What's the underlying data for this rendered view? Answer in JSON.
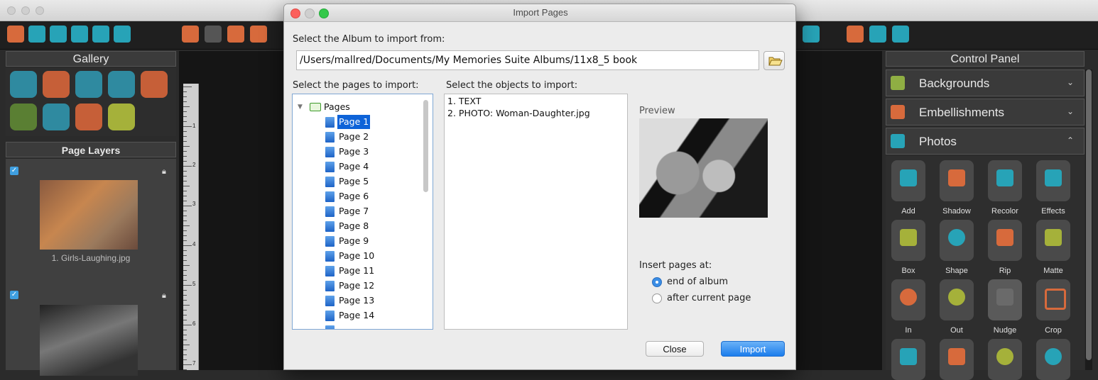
{
  "dialog": {
    "title": "Import Pages",
    "album_label": "Select the Album to import from:",
    "album_path": "/Users/mallred/Documents/My Memories Suite Albums/11x8_5 book",
    "pages_label": "Select the pages to import:",
    "objects_label": "Select the objects to import:",
    "tree_root": "Pages",
    "pages": [
      "Page 1",
      "Page 2",
      "Page 3",
      "Page 4",
      "Page 5",
      "Page 6",
      "Page 7",
      "Page 8",
      "Page 9",
      "Page 10",
      "Page 11",
      "Page 12",
      "Page 13",
      "Page 14"
    ],
    "selected_page": "Page 1",
    "objects": [
      "1. TEXT",
      "2. PHOTO: Woman-Daughter.jpg"
    ],
    "preview_label": "Preview",
    "insert_label": "Insert pages at:",
    "insert_options": [
      "end of album",
      "after current page"
    ],
    "insert_selected": "end of album",
    "close_label": "Close",
    "import_label": "Import"
  },
  "gallery": {
    "title": "Gallery"
  },
  "page_layers": {
    "title": "Page Layers",
    "items": [
      {
        "caption": "1. Girls-Laughing.jpg",
        "checked": true
      },
      {
        "caption": "",
        "checked": true
      }
    ]
  },
  "ruler": {
    "numbers": [
      "1",
      "2",
      "3",
      "4",
      "5",
      "6",
      "7"
    ]
  },
  "control_panel": {
    "title": "Control Panel",
    "sections": [
      {
        "label": "Backgrounds",
        "icon": "landscape-icon",
        "state": "collapsed"
      },
      {
        "label": "Embellishments",
        "icon": "flower-icon",
        "state": "collapsed"
      },
      {
        "label": "Photos",
        "icon": "camera-icon",
        "state": "expanded"
      }
    ],
    "tools": [
      "Add",
      "Shadow",
      "Recolor",
      "Effects",
      "Box",
      "Shape",
      "Rip",
      "Matte",
      "In",
      "Out",
      "Nudge",
      "Crop"
    ]
  },
  "colors": {
    "accent_blue": "#1b7cec",
    "selection_blue": "#0e63d8",
    "tool_orange": "#d76a3c",
    "tool_teal": "#27a3b7"
  }
}
